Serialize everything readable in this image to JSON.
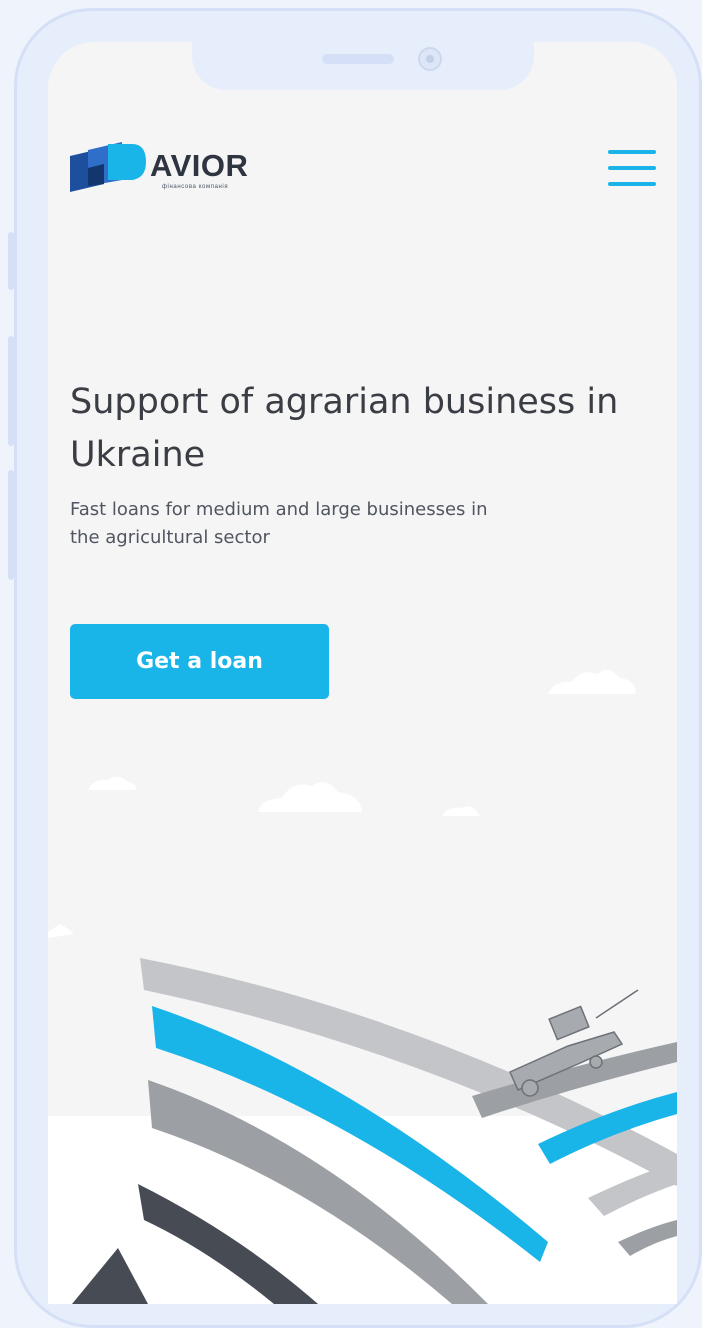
{
  "header": {
    "logo_text": "AVIOR",
    "logo_subtitle": "фінансова компанія",
    "menu_icon": "hamburger-menu-icon"
  },
  "hero": {
    "title": "Support of agrarian business in Ukraine",
    "subtitle": "Fast loans for medium and large businesses in the agricultural sector",
    "cta_label": "Get a loan"
  },
  "colors": {
    "accent": "#19b4e8",
    "logo_dark_blue": "#1d4f9c",
    "logo_blue": "#2f6fc9",
    "text_dark": "#3a3d44",
    "background": "#f5f5f6",
    "stripe_gray": "#9c9fa3",
    "stripe_light": "#c3c5c8",
    "stripe_dark": "#474b54"
  }
}
